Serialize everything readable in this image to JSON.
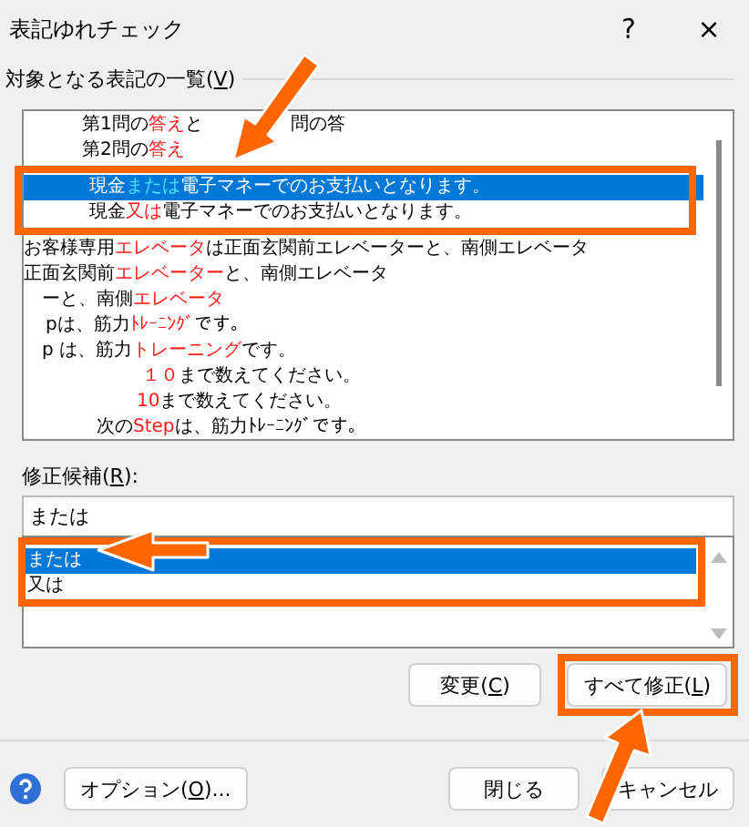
{
  "window": {
    "title": "表記ゆれチェック",
    "help": "?",
    "close": "×"
  },
  "targets": {
    "label_before": "対象となる表記の一覧(",
    "access_key": "V",
    "label_after": ")",
    "rows": [
      {
        "selected": false,
        "segments": [
          {
            "text": "第1問の",
            "marked": false
          },
          {
            "text": "答え",
            "marked": true
          },
          {
            "text": "と",
            "marked": false
          },
          {
            "text": "問の答",
            "marked": false
          }
        ]
      },
      {
        "selected": false,
        "segments": [
          {
            "text": "第2問の",
            "marked": false
          },
          {
            "text": "答え",
            "marked": true
          }
        ]
      },
      {
        "selected": true,
        "segments": [
          {
            "text": "現金",
            "marked": false
          },
          {
            "text": "または",
            "marked": true
          },
          {
            "text": "電子マネーでのお支払いとなります。",
            "marked": false
          }
        ]
      },
      {
        "selected": false,
        "segments": [
          {
            "text": "現金",
            "marked": false
          },
          {
            "text": "又は",
            "marked": true
          },
          {
            "text": "電子マネーでのお支払いとなります。",
            "marked": false
          }
        ]
      },
      {
        "selected": false,
        "segments": [
          {
            "text": "お客様専用",
            "marked": false
          },
          {
            "text": "エレベータ",
            "marked": true
          },
          {
            "text": "は正面玄関前エレベーターと、南側エレベータ",
            "marked": false
          }
        ]
      },
      {
        "selected": false,
        "segments": [
          {
            "text": "正面玄関前",
            "marked": false
          },
          {
            "text": "エレベーター",
            "marked": true
          },
          {
            "text": "と、南側エレベータ",
            "marked": false
          }
        ]
      },
      {
        "selected": false,
        "segments": [
          {
            "text": "ーと、南側",
            "marked": false
          },
          {
            "text": "エレベータ",
            "marked": true
          }
        ]
      },
      {
        "selected": false,
        "segments": [
          {
            "text": "pは、筋力",
            "marked": false
          },
          {
            "text": "ﾄﾚｰﾆﾝｸﾞ",
            "marked": true
          },
          {
            "text": "です。",
            "marked": false
          }
        ]
      },
      {
        "selected": false,
        "segments": [
          {
            "text": "p は、筋力",
            "marked": false
          },
          {
            "text": "トレーニング",
            "marked": true
          },
          {
            "text": "です。",
            "marked": false
          }
        ]
      },
      {
        "selected": false,
        "segments": [
          {
            "text": "１０",
            "marked": true
          },
          {
            "text": "まで数えてください。",
            "marked": false
          }
        ]
      },
      {
        "selected": false,
        "segments": [
          {
            "text": "10",
            "marked": true
          },
          {
            "text": "まで数えてください。",
            "marked": false
          }
        ]
      },
      {
        "selected": false,
        "segments": [
          {
            "text": "次の",
            "marked": false
          },
          {
            "text": "Step",
            "marked": true
          },
          {
            "text": "は、筋力ﾄﾚｰﾆﾝｸﾞです。",
            "marked": false
          }
        ]
      }
    ]
  },
  "candidates": {
    "label_before": "修正候補(",
    "access_key": "R",
    "label_after": "):",
    "value": "または",
    "items": [
      {
        "text": "または",
        "selected": true
      },
      {
        "text": "又は",
        "selected": false
      }
    ]
  },
  "actions": [
    {
      "label_before": "変更(",
      "access_key": "C",
      "label_after": ")"
    },
    {
      "label_before": "すべて修正(",
      "access_key": "L",
      "label_after": ")"
    }
  ],
  "footer": {
    "options": {
      "label_before": "オプション(",
      "access_key": "O",
      "label_after": ")..."
    },
    "buttons": [
      "閉じる",
      "キャンセル"
    ]
  }
}
